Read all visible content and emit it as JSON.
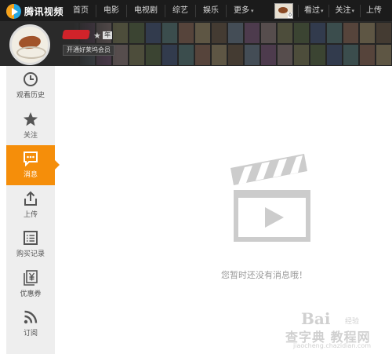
{
  "app": {
    "logo_text": "腾讯视频"
  },
  "nav": {
    "items": [
      {
        "label": "首页"
      },
      {
        "label": "电影"
      },
      {
        "label": "电视剧"
      },
      {
        "label": "综艺"
      },
      {
        "label": "娱乐"
      },
      {
        "label": "更多"
      }
    ],
    "more_caret": "▾"
  },
  "right_nav": {
    "avatar_tag": "0",
    "watched": "看过",
    "follow": "关注",
    "upload": "上传",
    "caret": "▾"
  },
  "profile": {
    "year_badge": "年",
    "vip_button": "开通好莱坞会员"
  },
  "sidebar": {
    "items": [
      {
        "label": "观看历史",
        "icon": "clock-icon"
      },
      {
        "label": "关注",
        "icon": "star-icon"
      },
      {
        "label": "消息",
        "icon": "message-icon",
        "active": true
      },
      {
        "label": "上传",
        "icon": "upload-icon"
      },
      {
        "label": "购买记录",
        "icon": "list-icon"
      },
      {
        "label": "优惠券",
        "icon": "coupon-icon"
      },
      {
        "label": "订阅",
        "icon": "rss-icon"
      }
    ]
  },
  "empty_state": {
    "message": "您暂时还没有消息哦！",
    "icon": "clapperboard-icon"
  },
  "watermark": {
    "logo": "Bai",
    "sub": "经验",
    "big": "查字典  教程网",
    "url": "jiaocheng.chazidian.com"
  },
  "colors": {
    "topbar": "#1b1b1b",
    "accent": "#f58e0a",
    "sidebar_bg": "#eeeeee",
    "icon_gray": "#cccccc"
  }
}
